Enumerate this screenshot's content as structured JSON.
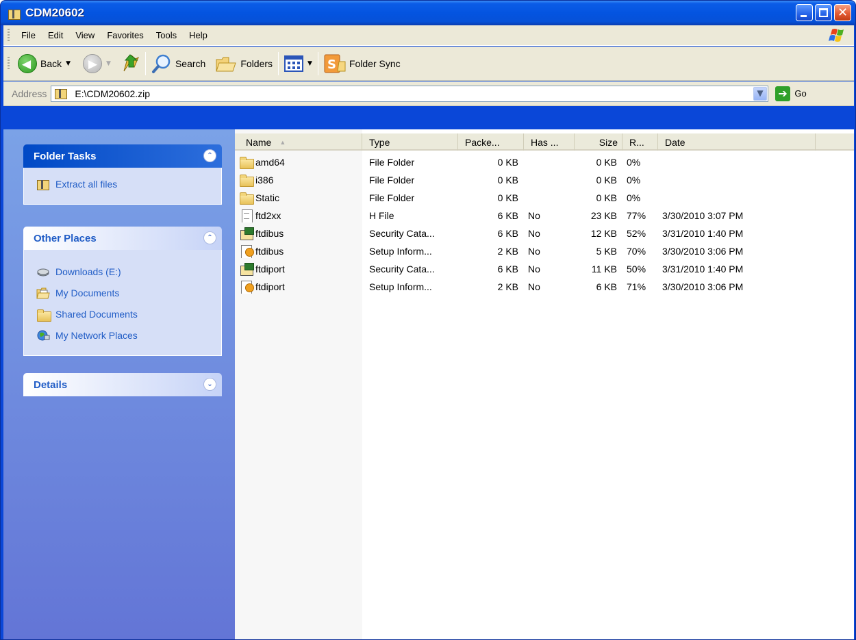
{
  "window": {
    "title": "CDM20602"
  },
  "menubar": {
    "items": [
      "File",
      "Edit",
      "View",
      "Favorites",
      "Tools",
      "Help"
    ]
  },
  "toolbar": {
    "back_label": "Back",
    "search_label": "Search",
    "folders_label": "Folders",
    "folder_sync_label": "Folder Sync"
  },
  "address": {
    "label": "Address",
    "value": "E:\\CDM20602.zip",
    "go_label": "Go"
  },
  "taskpane": {
    "folder_tasks": {
      "title": "Folder Tasks",
      "links": [
        "Extract all files"
      ]
    },
    "other_places": {
      "title": "Other Places",
      "links": [
        "Downloads (E:)",
        "My Documents",
        "Shared Documents",
        "My Network Places"
      ]
    },
    "details": {
      "title": "Details"
    }
  },
  "filelist": {
    "columns": [
      "Name",
      "Type",
      "Packe...",
      "Has ...",
      "Size",
      "R...",
      "Date"
    ],
    "rows": [
      {
        "name": "amd64",
        "icon": "folder-icon",
        "type": "File Folder",
        "packed": "0 KB",
        "has": "",
        "size": "0 KB",
        "ratio": "0%",
        "date": ""
      },
      {
        "name": "i386",
        "icon": "folder-icon",
        "type": "File Folder",
        "packed": "0 KB",
        "has": "",
        "size": "0 KB",
        "ratio": "0%",
        "date": ""
      },
      {
        "name": "Static",
        "icon": "folder-icon",
        "type": "File Folder",
        "packed": "0 KB",
        "has": "",
        "size": "0 KB",
        "ratio": "0%",
        "date": ""
      },
      {
        "name": "ftd2xx",
        "icon": "document-icon",
        "type": "H File",
        "packed": "6 KB",
        "has": "No",
        "size": "23 KB",
        "ratio": "77%",
        "date": "3/30/2010 3:07 PM"
      },
      {
        "name": "ftdibus",
        "icon": "security-catalog-icon",
        "type": "Security Cata...",
        "packed": "6 KB",
        "has": "No",
        "size": "12 KB",
        "ratio": "52%",
        "date": "3/31/2010 1:40 PM"
      },
      {
        "name": "ftdibus",
        "icon": "setup-info-icon",
        "type": "Setup Inform...",
        "packed": "2 KB",
        "has": "No",
        "size": "5 KB",
        "ratio": "70%",
        "date": "3/30/2010 3:06 PM"
      },
      {
        "name": "ftdiport",
        "icon": "security-catalog-icon",
        "type": "Security Cata...",
        "packed": "6 KB",
        "has": "No",
        "size": "11 KB",
        "ratio": "50%",
        "date": "3/31/2010 1:40 PM"
      },
      {
        "name": "ftdiport",
        "icon": "setup-info-icon",
        "type": "Setup Inform...",
        "packed": "2 KB",
        "has": "No",
        "size": "6 KB",
        "ratio": "71%",
        "date": "3/30/2010 3:06 PM"
      }
    ]
  },
  "colors": {
    "title_blue": "#0454e0",
    "taskpane_blue": "#7ba2e7",
    "link_blue": "#215dc6",
    "chrome_beige": "#ece9d8"
  }
}
